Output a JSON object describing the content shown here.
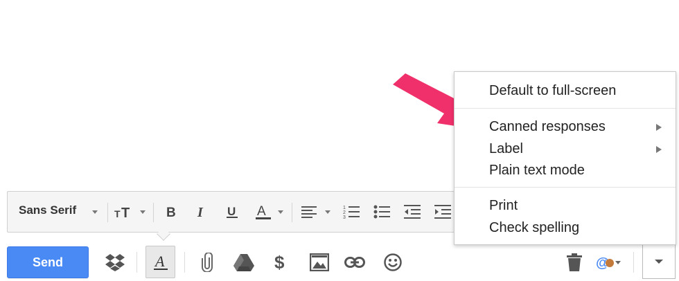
{
  "format_toolbar": {
    "font_family": "Sans Serif",
    "icons": [
      "font-size-icon",
      "bold-icon",
      "italic-icon",
      "underline-icon",
      "text-color-icon",
      "align-icon",
      "numbered-list-icon",
      "bulleted-list-icon",
      "indent-less-icon",
      "indent-more-icon"
    ]
  },
  "compose_bar": {
    "send_label": "Send",
    "icons": [
      "dropbox-icon",
      "formatting-icon",
      "attach-icon",
      "drive-icon",
      "money-icon",
      "photo-icon",
      "link-icon",
      "emoji-icon",
      "trash-icon",
      "signature-icon",
      "more-options-icon"
    ]
  },
  "menu": {
    "items": [
      {
        "label": "Default to full-screen",
        "submenu": false
      },
      {
        "label": "Canned responses",
        "submenu": true
      },
      {
        "label": "Label",
        "submenu": true
      },
      {
        "label": "Plain text mode",
        "submenu": false
      },
      {
        "label": "Print",
        "submenu": false
      },
      {
        "label": "Check spelling",
        "submenu": false
      }
    ]
  },
  "colors": {
    "send_button": "#4a8af4",
    "annotation_arrow": "#f0306a",
    "toolbar_bg": "#f5f5f5"
  }
}
